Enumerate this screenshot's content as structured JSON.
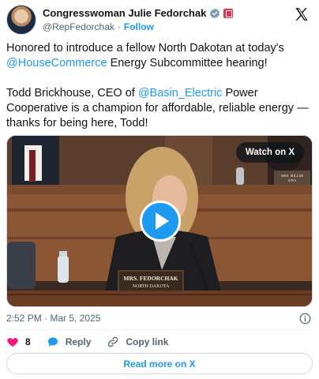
{
  "author": {
    "name": "Congresswoman Julie Fedorchak",
    "handle": "@RepFedorchak",
    "separator": "·",
    "follow_label": "Follow",
    "verified_icon": "verified-badge-icon",
    "flag_icon": "government-flag-icon"
  },
  "tweet": {
    "p1_before": "Honored to introduce a fellow North Dakotan at today's ",
    "p1_link": "@HouseCommerce",
    "p1_after": " Energy Subcommittee hearing!",
    "p2_before": "Todd Brickhouse, CEO of ",
    "p2_link": "@Basin_Electric",
    "p2_after": " Power Cooperative is a champion for affordable, reliable energy —thanks for being here, Todd!"
  },
  "media": {
    "watch_label": "Watch on X",
    "nameplate_line1": "MRS. FEDORCHAK",
    "nameplate_line2": "NORTH DAKOTA",
    "bg_nameplate_line1": "MRS. MILLER",
    "bg_nameplate_line2": "IOWA",
    "play_icon": "play-icon"
  },
  "timestamp": "2:52 PM · Mar 5, 2025",
  "actions": {
    "like_count": "8",
    "reply_label": "Reply",
    "copy_label": "Copy link"
  },
  "read_more_label": "Read more on X",
  "colors": {
    "accent": "#1d9bf0",
    "like": "#f91880",
    "text": "#0f1419",
    "muted": "#536471"
  }
}
